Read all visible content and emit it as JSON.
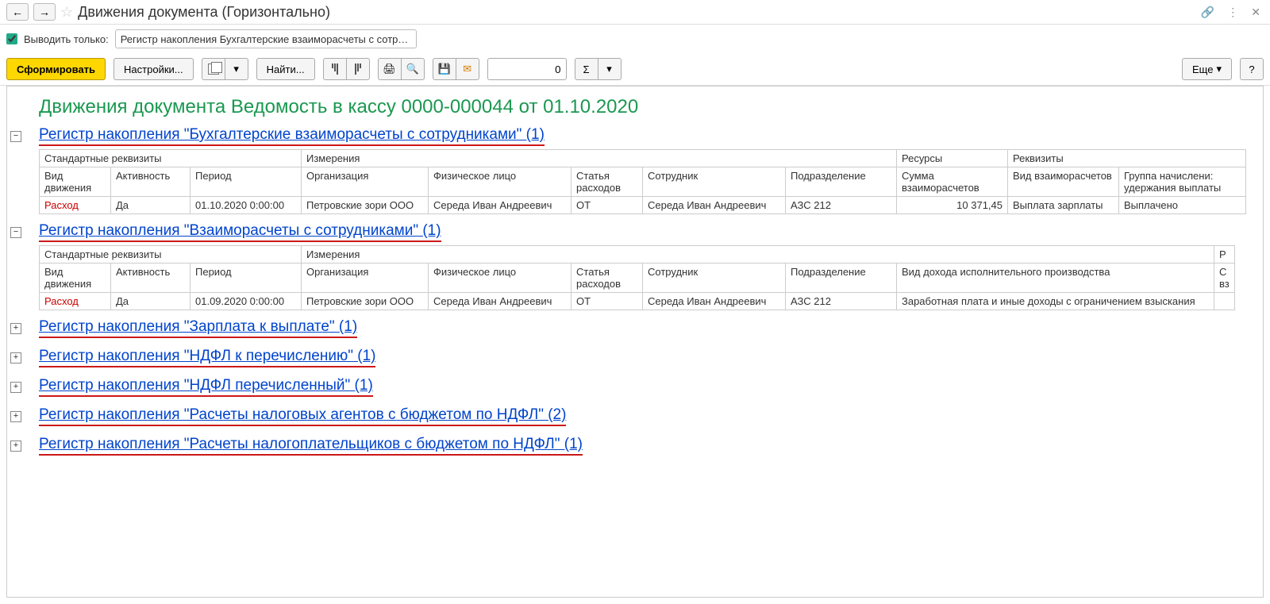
{
  "titlebar": {
    "title": "Движения документа (Горизонтально)"
  },
  "filter": {
    "checked": true,
    "label": "Выводить только:",
    "value": "Регистр накопления Бухгалтерские взаиморасчеты с сотрудник ..."
  },
  "toolbar": {
    "form": "Сформировать",
    "settings": "Настройки...",
    "find": "Найти...",
    "number": "0",
    "more": "Еще",
    "help": "?"
  },
  "report": {
    "title": "Движения документа Ведомость в кассу 0000-000044 от 01.10.2020"
  },
  "sections": [
    {
      "expanded": true,
      "title": "Регистр накопления \"Бухгалтерские взаиморасчеты с сотрудниками\" (1)",
      "group_headers": [
        "Стандартные реквизиты",
        "Измерения",
        "Ресурсы",
        "Реквизиты"
      ],
      "columns": [
        "Вид движения",
        "Активность",
        "Период",
        "Организация",
        "Физическое лицо",
        "Статья расходов",
        "Сотрудник",
        "Подразделение",
        "Сумма взаиморасчетов",
        "Вид взаиморасчетов",
        "Группа начислени: удержания выплаты"
      ],
      "rows": [
        [
          "Расход",
          "Да",
          "01.10.2020 0:00:00",
          "Петровские зори ООО",
          "Середа Иван Андреевич",
          "ОТ",
          "Середа Иван Андреевич",
          "АЗС 212",
          "10 371,45",
          "Выплата зарплаты",
          "Выплачено"
        ]
      ]
    },
    {
      "expanded": true,
      "title": "Регистр накопления \"Взаиморасчеты с сотрудниками\" (1)",
      "group_headers": [
        "Стандартные реквизиты",
        "Измерения",
        "Р"
      ],
      "columns": [
        "Вид движения",
        "Активность",
        "Период",
        "Организация",
        "Физическое лицо",
        "Статья расходов",
        "Сотрудник",
        "Подразделение",
        "Вид дохода исполнительного производства",
        "С вз"
      ],
      "rows": [
        [
          "Расход",
          "Да",
          "01.09.2020 0:00:00",
          "Петровские зори ООО",
          "Середа Иван Андреевич",
          "ОТ",
          "Середа Иван Андреевич",
          "АЗС 212",
          "Заработная плата и иные доходы с ограничением взыскания",
          ""
        ]
      ]
    },
    {
      "expanded": false,
      "title": "Регистр накопления \"Зарплата к выплате\" (1)"
    },
    {
      "expanded": false,
      "title": "Регистр накопления \"НДФЛ к перечислению\" (1)"
    },
    {
      "expanded": false,
      "title": "Регистр накопления \"НДФЛ перечисленный\" (1)"
    },
    {
      "expanded": false,
      "title": "Регистр накопления \"Расчеты налоговых агентов с бюджетом по НДФЛ\" (2)"
    },
    {
      "expanded": false,
      "title": "Регистр накопления \"Расчеты налогоплательщиков с бюджетом по НДФЛ\" (1)"
    }
  ]
}
